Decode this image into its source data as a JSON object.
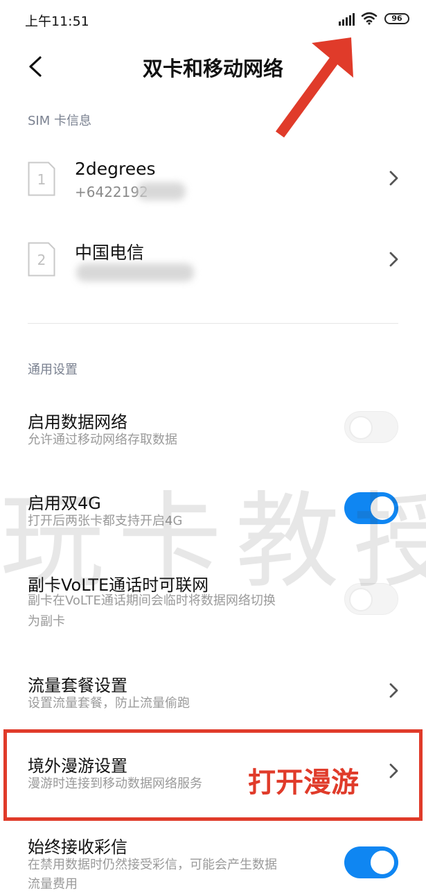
{
  "status_bar": {
    "time": "上午11:51",
    "battery": "96",
    "icons": [
      "signal-icon",
      "wifi-icon",
      "battery-icon"
    ]
  },
  "header": {
    "title": "双卡和移动网络",
    "back_icon": "chevron-left-icon"
  },
  "sim_section": {
    "header": "SIM 卡信息",
    "cards": [
      {
        "slot": "1",
        "name": "2degrees",
        "number": "+6422192"
      },
      {
        "slot": "2",
        "name": "中国电信",
        "number": ""
      }
    ]
  },
  "general_section": {
    "header": "通用设置",
    "items": [
      {
        "title": "启用数据网络",
        "desc": "允许通过移动网络存取数据",
        "control": "toggle",
        "on": false
      },
      {
        "title": "启用双4G",
        "desc": "打开后两张卡都支持开启4G",
        "control": "toggle",
        "on": true
      },
      {
        "title": "副卡VoLTE通话时可联网",
        "desc": "副卡在VoLTE通话期间会临时将数据网络切换为副卡",
        "desc_line1": "副卡在VoLTE通话期间会临时将数据网络切换",
        "desc_line2": "为副卡",
        "control": "toggle",
        "on": false
      },
      {
        "title": "流量套餐设置",
        "desc": "设置流量套餐，防止流量偷跑",
        "control": "chevron"
      },
      {
        "title": "境外漫游设置",
        "desc": "漫游时连接到移动数据网络服务",
        "control": "chevron"
      },
      {
        "title": "始终接收彩信",
        "desc": "在禁用数据时仍然接受彩信，可能会产生数据流量费用",
        "desc_line1": "在禁用数据时仍然接受彩信，可能会产生数据",
        "desc_line2": "流量费用",
        "control": "toggle",
        "on": true
      }
    ]
  },
  "overlay": {
    "watermark": "玩卡教授",
    "annotation": "打开漫游",
    "accent_color": "#e03b2a",
    "toggle_on_color": "#0f86f2"
  }
}
